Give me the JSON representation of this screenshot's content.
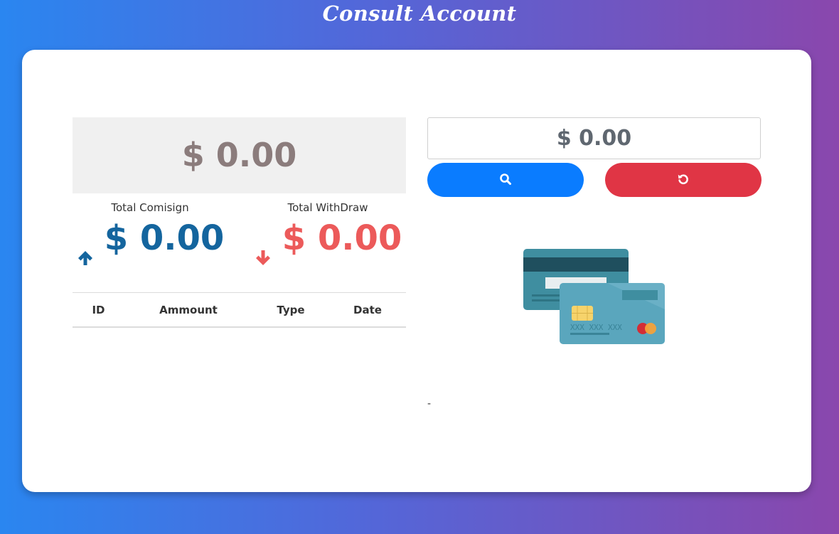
{
  "page": {
    "title": "Consult Account"
  },
  "balance": {
    "value": "$ 0.00"
  },
  "stats": {
    "comision": {
      "label": "Total Comisign",
      "value": "$ 0.00",
      "icon": "arrow-up-icon",
      "color": "#14659e"
    },
    "withdraw": {
      "label": "Total WithDraw",
      "value": "$ 0.00",
      "icon": "arrow-down-icon",
      "color": "#ec5a5a"
    }
  },
  "table": {
    "columns": [
      "ID",
      "Ammount",
      "Type",
      "Date"
    ],
    "rows": []
  },
  "search": {
    "amount_value": "$ 0.00",
    "search_icon": "search-icon",
    "search_color": "#0a7cff",
    "reset_icon": "refresh-icon",
    "reset_color": "#e03545"
  },
  "illustration": {
    "icon": "credit-cards-icon",
    "card_number": "XXX XXX XXX"
  },
  "footnote": {
    "text": "-"
  }
}
